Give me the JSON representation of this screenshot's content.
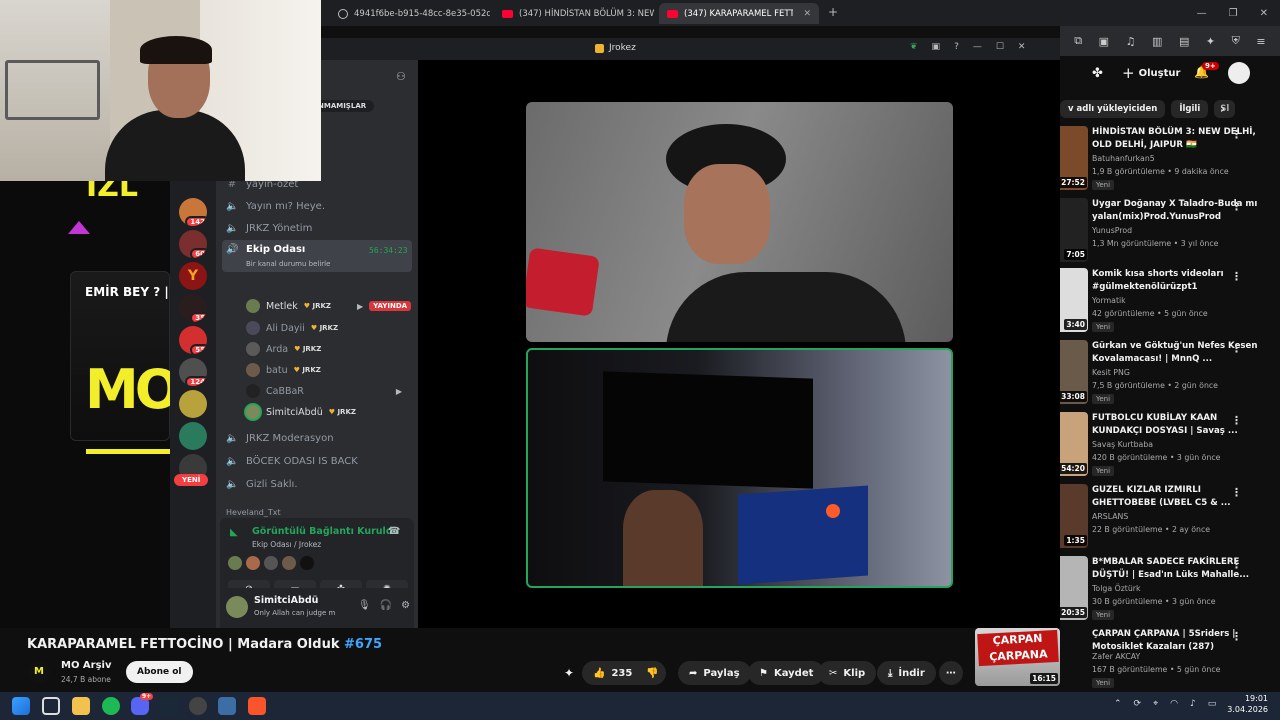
{
  "browser": {
    "tabs": [
      {
        "title": "4941f6be-b915-48cc-8e35-052d05d"
      },
      {
        "title": "(347) HİNDİSTAN BÖLÜM 3: NEW DE"
      },
      {
        "title": "(347) KARAPARAMEL FETTOCİNO"
      }
    ],
    "new_tab": "+"
  },
  "discord": {
    "window_title": "Jrokez",
    "badge_top": "NMAMIŞLAR",
    "guild_badges": [
      "142",
      "60",
      "35",
      "55",
      "124"
    ],
    "guild_new": "YENİ",
    "channels": {
      "yayin_ozet": "yayın-özet",
      "yayin_mi": "Yayın mı? Heye.",
      "yonetim": "JRKZ Yönetim",
      "ekip": "Ekip Odası",
      "ekip_time": "56:34:23",
      "ekip_status": "Bir kanal durumu belirle",
      "moderasyon": "JRKZ Moderasyon",
      "bocek": "BÖCEK ODASI IS BACK",
      "gizli": "Gizli Saklı.",
      "heveland": "Heveland_Txt"
    },
    "members": [
      {
        "name": "Metlek",
        "tag": "JRKZ",
        "live": "YAYINDA"
      },
      {
        "name": "Ali Dayii",
        "tag": "JRKZ"
      },
      {
        "name": "Arda",
        "tag": "JRKZ"
      },
      {
        "name": "batu",
        "tag": "JRKZ"
      },
      {
        "name": "CaBBaR",
        "tag": ""
      },
      {
        "name": "SimitciAbdü",
        "tag": "JRKZ"
      }
    ],
    "voice_panel": {
      "status": "Görüntülü Bağlantı Kuruldu",
      "location": "Ekip Odası / Jrokez"
    },
    "user": {
      "name": "SimitciAbdü",
      "status": "Only Allah can judge m"
    }
  },
  "stream_overlay": {
    "text": "İZL",
    "card_title": "EMİR BEY ? | I",
    "logo": "MO"
  },
  "youtube": {
    "header": {
      "create": "Oluştur",
      "notif_count": "9+"
    },
    "chips": [
      "v adlı yükleyiciden",
      "İlgili",
      "Sl"
    ],
    "video": {
      "title": "KARAPARAMEL FETTOCİNO | Madara Olduk ",
      "hashtag": "#675",
      "channel": "MO Arşiv",
      "subs": "24,7 B abone",
      "subscribe": "Abone ol",
      "likes": "235",
      "share": "Paylaş",
      "save": "Kaydet",
      "clip": "Klip",
      "download": "İndir"
    },
    "recommendations": [
      {
        "title": "HİNDİSTAN BÖLÜM 3: NEW DELHİ, OLD DELHİ, JAIPUR 🇮🇳",
        "channel": "Batuhanfurkan5",
        "meta": "1,9 B görüntüleme • 9 dakika önce",
        "duration": "27:52",
        "new": "Yeni"
      },
      {
        "title": "Uygar Doğanay X Taladro-Buda mı yalan(mix)Prod.YunusProd",
        "channel": "YunusProd",
        "meta": "1,3 Mn görüntüleme • 3 yıl önce",
        "duration": "7:05",
        "new": ""
      },
      {
        "title": "Komik kısa shorts videoları #gülmektenölürüzpt1",
        "channel": "Yormatik",
        "meta": "42 görüntüleme • 5 gün önce",
        "duration": "3:40",
        "new": "Yeni"
      },
      {
        "title": "Gürkan ve Göktuğ'un Nefes Kesen Kovalamacası! | MnnQ ...",
        "channel": "Kesit PNG",
        "meta": "7,5 B görüntüleme • 2 gün önce",
        "duration": "33:08",
        "new": "Yeni"
      },
      {
        "title": "FUTBOLCU KUBİLAY KAAN KUNDAKÇI DOSYASI | Savaş ...",
        "channel": "Savaş Kurtbaba",
        "meta": "420 B görüntüleme • 3 gün önce",
        "duration": "54:20",
        "new": "Yeni"
      },
      {
        "title": "GUZEL KIZLAR IZMIRLI GHETTOBEBE (LVBEL C5 & ...",
        "channel": "ARSLANS",
        "meta": "22 B görüntüleme • 2 ay önce",
        "duration": "1:35",
        "new": ""
      },
      {
        "title": "B*MBALAR SADECE FAKİRLERE DÜŞTÜ! | Esad'ın Lüks Mahalle...",
        "channel": "Tolga Öztürk",
        "meta": "30 B görüntüleme • 3 gün önce",
        "duration": "20:35",
        "new": "Yeni"
      },
      {
        "title": "ÇARPAN ÇARPANA | 5Sriders | Motosiklet Kazaları (287)",
        "channel": "Zafer AKCAY",
        "meta": "167 B görüntüleme • 5 gün önce",
        "duration": "16:15",
        "new": "Yeni",
        "thumb_text": "ÇARPAN ÇARPANA"
      }
    ]
  },
  "taskbar": {
    "time": "19:01",
    "date": "3.04.2026",
    "steam_badge": "9+"
  },
  "colors": {
    "discord_green": "#23a55a",
    "live_red": "#da373c",
    "yt_red": "#ff0033",
    "hashtag": "#3ea6ff",
    "gold": "#f0b232"
  }
}
